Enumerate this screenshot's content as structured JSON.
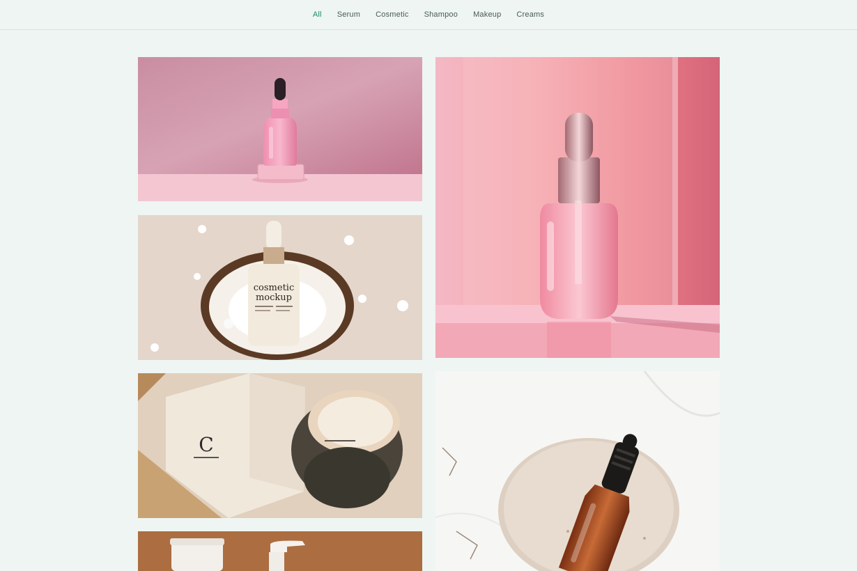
{
  "filter_tabs": [
    {
      "label": "All",
      "active": true
    },
    {
      "label": "Serum",
      "active": false
    },
    {
      "label": "Cosmetic",
      "active": false
    },
    {
      "label": "Shampoo",
      "active": false
    },
    {
      "label": "Makeup",
      "active": false
    },
    {
      "label": "Creams",
      "active": false
    }
  ],
  "colors": {
    "accent": "#1f8a63",
    "page_bg": "#eef5f2",
    "tab_text": "#4a5a55"
  },
  "gallery": {
    "items": [
      {
        "name": "pink-serum-dropper-photo",
        "label_lines": []
      },
      {
        "name": "coconut-cosmetic-mockup-photo",
        "label_lines": [
          "cosmetic",
          "mockup"
        ]
      },
      {
        "name": "cream-jar-and-box-photo",
        "label_lines": [
          "C"
        ]
      },
      {
        "name": "tube-and-pump-photo",
        "label_lines": []
      },
      {
        "name": "pink-dropper-bottle-photo",
        "label_lines": []
      },
      {
        "name": "amber-dropper-on-stone-photo",
        "label_lines": []
      }
    ]
  }
}
